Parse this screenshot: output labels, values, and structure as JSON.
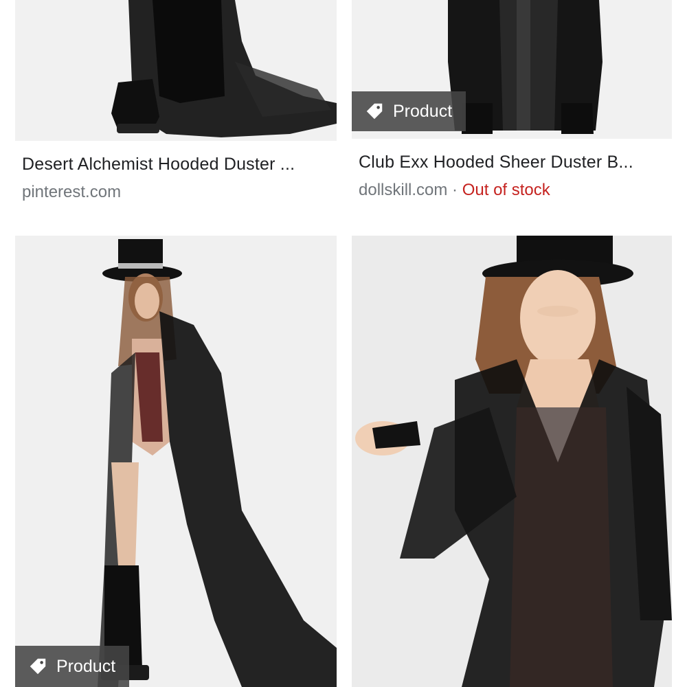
{
  "results": [
    {
      "title": "Desert Alchemist Hooded Duster ...",
      "source": "pinterest.com",
      "badge": "",
      "stock": ""
    },
    {
      "title": "Club Exx Hooded Sheer Duster B...",
      "source": "dollskill.com",
      "separator": "·",
      "badge": "Product",
      "stock": "Out of stock"
    },
    {
      "badge": "Product"
    },
    {
      "badge": ""
    }
  ],
  "colors": {
    "stock_status": "#c5221f",
    "badge_bg": "#464646",
    "source_text": "#70757a",
    "title_text": "#202124"
  },
  "icons": {
    "badge_icon": "tag-icon"
  }
}
